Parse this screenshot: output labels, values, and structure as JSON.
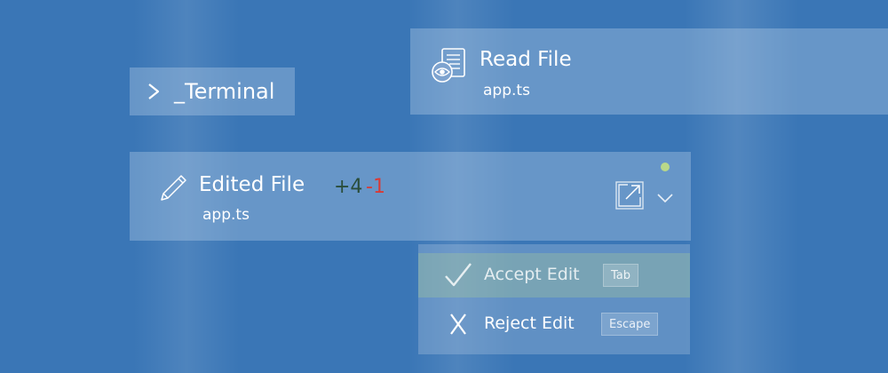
{
  "terminal_chip": {
    "label": "_Terminal"
  },
  "read_file": {
    "title": "Read File",
    "filename": "app.ts"
  },
  "edited_file": {
    "title": "Edited File",
    "filename": "app.ts",
    "added": "+4",
    "removed": "-1"
  },
  "edit_menu": {
    "accept": {
      "label": "Accept Edit",
      "shortcut": "Tab"
    },
    "reject": {
      "label": "Reject Edit",
      "shortcut": "Escape"
    }
  },
  "icons": {
    "terminal": "chevron-prompt-icon",
    "read_file": "document-eye-icon",
    "edited_file": "pencil-icon",
    "open_external": "open-external-icon",
    "expand": "chevron-down-icon",
    "accept": "checkmark-icon",
    "reject": "x-icon",
    "status": "status-dot-icon"
  },
  "colors": {
    "background": "#3a76b6",
    "added": "#2a4d3a",
    "removed": "#d83a36",
    "status_dot": "#b9d889"
  }
}
